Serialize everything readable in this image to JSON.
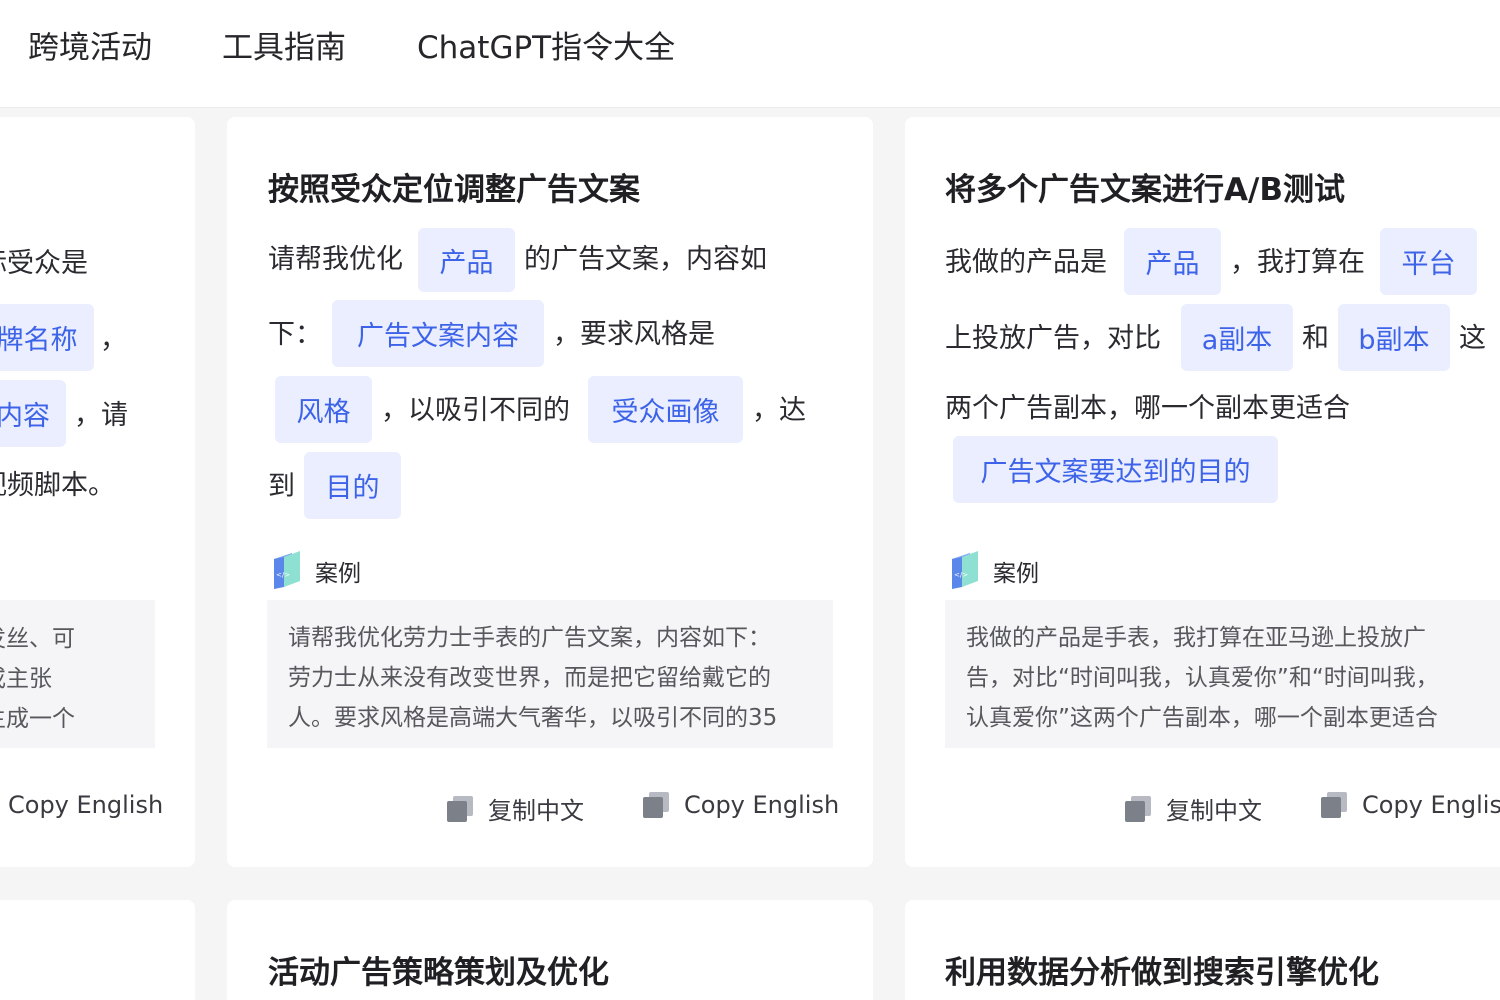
{
  "nav": {
    "items": [
      {
        "label": "跨境活动"
      },
      {
        "label": "工具指南"
      },
      {
        "label": "ChatGPT指令大全"
      }
    ]
  },
  "left_card": {
    "lines": [
      "标受众是",
      "，",
      "，请",
      "视频脚本。"
    ],
    "chips": [
      "牌名称",
      "内容"
    ],
    "example_lines": [
      "人发丝、可",
      "值或主张",
      "容生成一个"
    ],
    "copy_english": "Copy English"
  },
  "card1": {
    "title": "按照受众定位调整广告文案",
    "text": [
      "请帮我优化",
      "的广告文案，内容如",
      "下：",
      "，要求风格是",
      "，以吸引不同的",
      "，达",
      "到"
    ],
    "chips": [
      "产品",
      "广告文案内容",
      "风格",
      "受众画像",
      "目的"
    ],
    "case_label": "案例",
    "example_lines": [
      "请帮我优化劳力士手表的广告文案，内容如下：",
      "劳力士从来没有改变世界，而是把它留给戴它的",
      "人。要求风格是高端大气奢华，以吸引不同的35"
    ],
    "copy_chinese": "复制中文",
    "copy_english": "Copy English"
  },
  "card2": {
    "title": "将多个广告文案进行A/B测试",
    "text": [
      "我做的产品是",
      "，我打算在",
      "上投放广告，对比",
      "和",
      "这",
      "两个广告副本，哪一个副本更适合"
    ],
    "chips": [
      "产品",
      "平台",
      "a副本",
      "b副本",
      "广告文案要达到的目的"
    ],
    "case_label": "案例",
    "example_lines": [
      "我做的产品是手表，我打算在亚马逊上投放广",
      "告，对比“时间叫我，认真爱你”和“时间叫我，",
      "认真爱你”这两个广告副本，哪一个副本更适合"
    ],
    "copy_chinese": "复制中文",
    "copy_english": "Copy English"
  },
  "bottom_cards": [
    {
      "title": "活动广告策略策划及优化"
    },
    {
      "title": "利用数据分析做到搜索引擎优化"
    }
  ],
  "icons": {
    "case": "code-file-icon",
    "copy": "copy-icon"
  },
  "colors": {
    "chip_bg": "#eaeefe",
    "chip_text": "#3d63e8",
    "background": "#f5f5f6"
  }
}
